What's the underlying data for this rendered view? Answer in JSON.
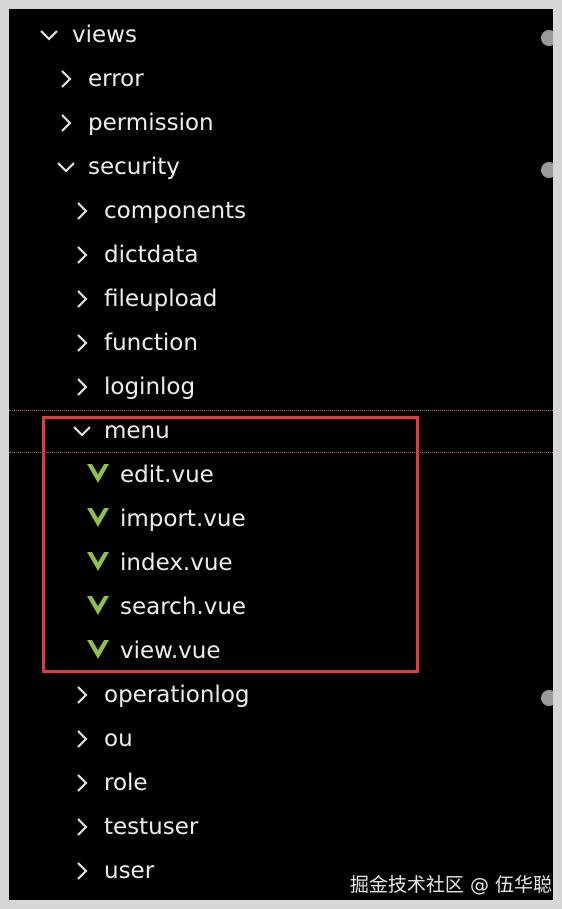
{
  "colors": {
    "background": "#000000",
    "text": "#ececec",
    "vue_icon": "#8dc149",
    "highlight_border": "#e0393e",
    "guide_line": "#c0704a"
  },
  "tree": {
    "views": {
      "label": "views",
      "expanded": true
    },
    "error": {
      "label": "error",
      "expanded": false
    },
    "permission": {
      "label": "permission",
      "expanded": false
    },
    "security": {
      "label": "security",
      "expanded": true
    },
    "components": {
      "label": "components",
      "expanded": false
    },
    "dictdata": {
      "label": "dictdata",
      "expanded": false
    },
    "fileupload": {
      "label": "fileupload",
      "expanded": false
    },
    "function": {
      "label": "function",
      "expanded": false
    },
    "loginlog": {
      "label": "loginlog",
      "expanded": false
    },
    "menu": {
      "label": "menu",
      "expanded": true
    },
    "edit": {
      "label": "edit.vue",
      "icon": "vue-file-icon"
    },
    "import": {
      "label": "import.vue",
      "icon": "vue-file-icon"
    },
    "index": {
      "label": "index.vue",
      "icon": "vue-file-icon"
    },
    "search": {
      "label": "search.vue",
      "icon": "vue-file-icon"
    },
    "view": {
      "label": "view.vue",
      "icon": "vue-file-icon"
    },
    "operationlog": {
      "label": "operationlog",
      "expanded": false
    },
    "ou": {
      "label": "ou",
      "expanded": false
    },
    "role": {
      "label": "role",
      "expanded": false
    },
    "testuser": {
      "label": "testuser",
      "expanded": false
    },
    "user": {
      "label": "user",
      "expanded": false
    }
  },
  "watermark": "掘金技术社区 @ 伍华聪"
}
